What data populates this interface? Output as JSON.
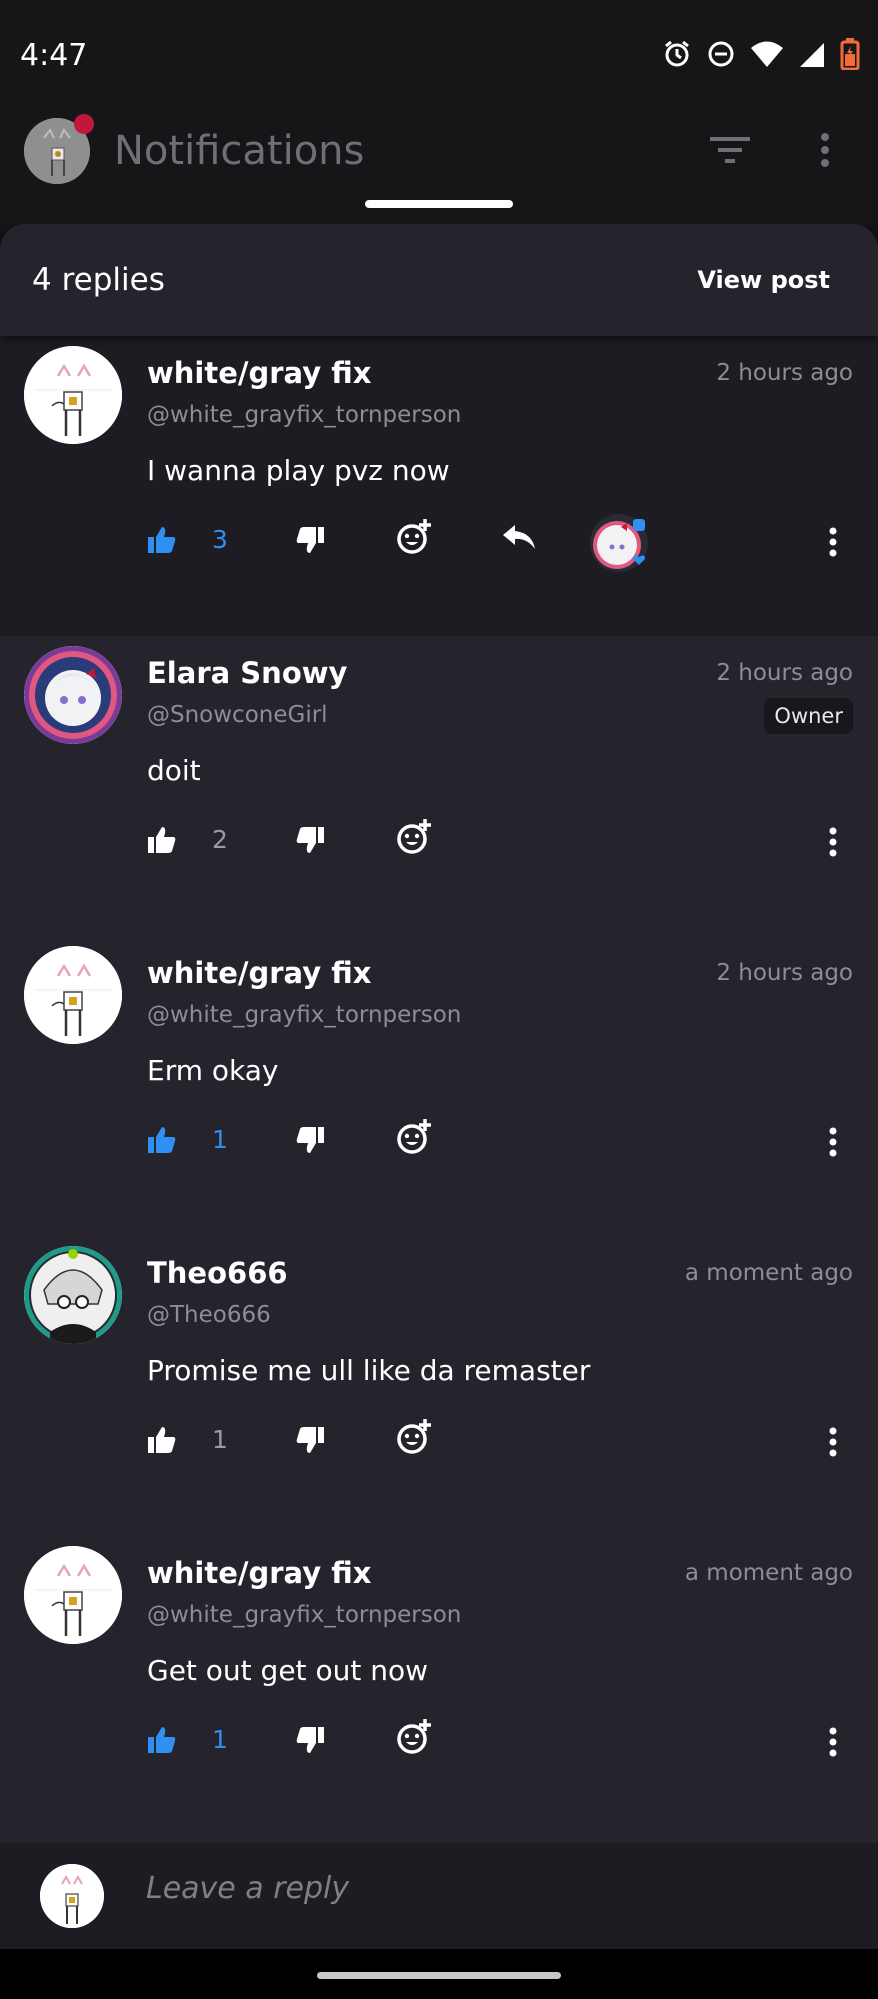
{
  "status_bar": {
    "time": "4:47",
    "icons": [
      "alarm-icon",
      "dnd-icon",
      "wifi-icon",
      "signal-icon",
      "battery-icon"
    ]
  },
  "app_bar": {
    "title": "Notifications",
    "notification_dot_color": "#c0173b"
  },
  "sheet": {
    "replies_count": "4 replies",
    "view_post": "View post"
  },
  "colors": {
    "accent_blue": "#2f8ff2",
    "sheet_bg": "#25242c",
    "highlight_bg": "#1d1c22"
  },
  "comments": [
    {
      "name": "white/gray fix",
      "handle": "@white_grayfix_tornperson",
      "time": "2 hours ago",
      "text": "I wanna play pvz now",
      "likes": "3",
      "liked": true
    },
    {
      "name": "Elara Snowy",
      "handle": "@SnowconeGirl",
      "time": "2 hours ago",
      "badge": "Owner",
      "text": "doit",
      "likes": "2",
      "liked": false
    },
    {
      "name": "white/gray fix",
      "handle": "@white_grayfix_tornperson",
      "time": "2 hours ago",
      "text": "Erm okay",
      "likes": "1",
      "liked": true
    },
    {
      "name": "Theo666",
      "handle": "@Theo666",
      "time": "a moment ago",
      "text": "Promise me ull like da remaster",
      "likes": "1",
      "liked": false
    },
    {
      "name": "white/gray fix",
      "handle": "@white_grayfix_tornperson",
      "time": "a moment ago",
      "text": "Get out get out now",
      "likes": "1",
      "liked": true
    }
  ],
  "reply_bar": {
    "placeholder": "Leave a reply"
  }
}
